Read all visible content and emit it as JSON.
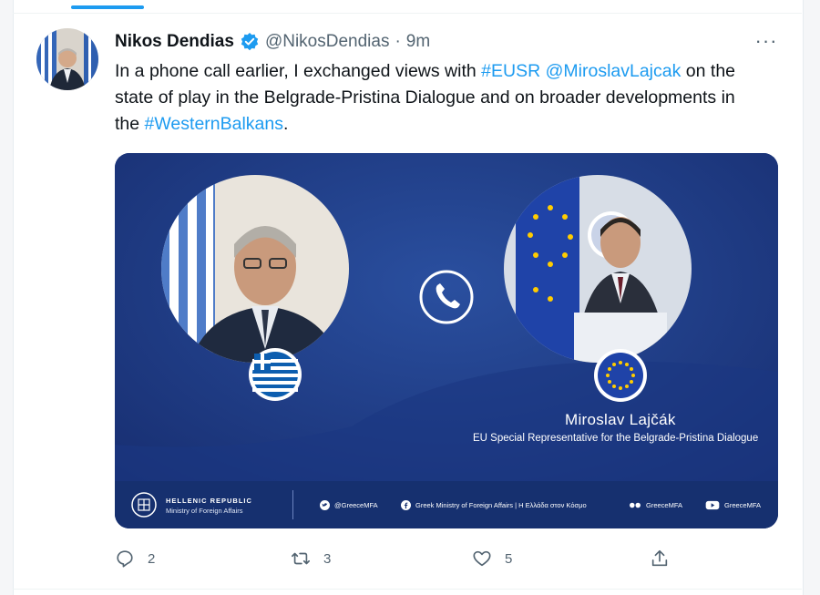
{
  "tweet": {
    "author_name": "Nikos Dendias",
    "handle": "@NikosDendias",
    "separator": "·",
    "time": "9m",
    "more_label": "···",
    "text_parts": [
      "In a phone call earlier, I exchanged views with ",
      "#EUSR",
      " ",
      "@MiroslavLajcak",
      " on the state of play in the Belgrade-Pristina Dialogue and on broader developments in the ",
      "#WesternBalkans",
      "."
    ]
  },
  "media": {
    "right_name": "Miroslav Lajčák",
    "right_role": "EU Special Representative for the Belgrade-Pristina Dialogue",
    "footer": {
      "ministry_title": "HELLENIC REPUBLIC",
      "ministry_subtitle": "Ministry of Foreign Affairs",
      "twitter": "@GreeceMFA",
      "facebook": "Greek Ministry of Foreign Affairs | Η Ελλάδα στον Κόσμο",
      "flickr": "GreeceMFA",
      "youtube": "GreeceMFA"
    },
    "colors": {
      "background": "#1e3c88",
      "footer": "#16306f"
    }
  },
  "actions": {
    "reply_count": "2",
    "retweet_count": "3",
    "like_count": "5"
  },
  "colors": {
    "link": "#1d9bf0",
    "secondary": "#536471",
    "text": "#0f1419"
  }
}
